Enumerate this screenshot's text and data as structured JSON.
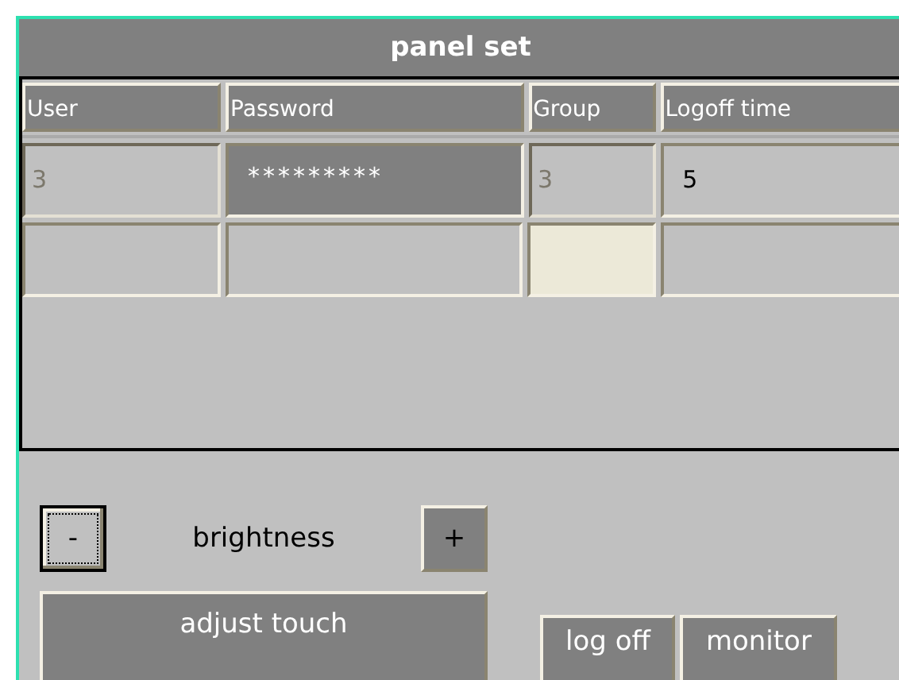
{
  "window": {
    "title": "panel set"
  },
  "table": {
    "columns": [
      "User",
      "Password",
      "Group",
      "Logoff time"
    ],
    "rows": [
      {
        "cells": [
          {
            "kind": "text",
            "value": "3",
            "disabled": true,
            "selected": false
          },
          {
            "kind": "password",
            "value": "*********",
            "disabled": false,
            "selected": false
          },
          {
            "kind": "text",
            "value": "3",
            "disabled": true,
            "selected": false
          },
          {
            "kind": "text",
            "value": "5",
            "disabled": false,
            "selected": false
          }
        ]
      },
      {
        "cells": [
          {
            "kind": "text",
            "disabled": false,
            "selected": false
          },
          {
            "kind": "text",
            "disabled": false,
            "selected": false
          },
          {
            "kind": "text",
            "disabled": false,
            "selected": true
          },
          {
            "kind": "text",
            "disabled": false,
            "selected": false
          }
        ]
      }
    ]
  },
  "brightness": {
    "minus": {
      "label": "-",
      "focused": true
    },
    "label": "brightness",
    "plus": {
      "label": "+",
      "focused": false
    }
  },
  "buttons": [
    {
      "kind": "wide",
      "label": "adjust touch"
    },
    {
      "kind": "small",
      "label": "log off"
    },
    {
      "kind": "small",
      "label": "monitor"
    }
  ]
}
